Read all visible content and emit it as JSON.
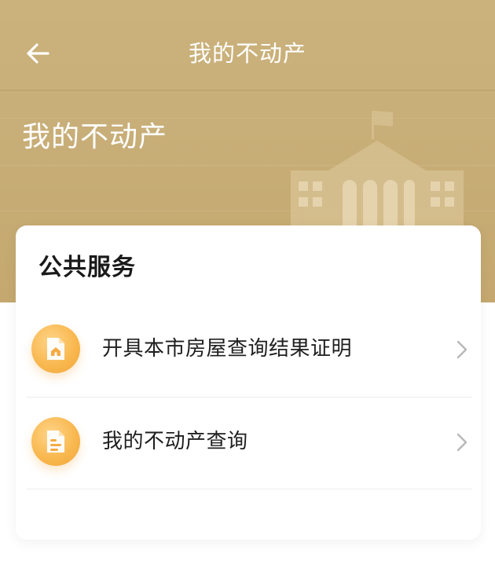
{
  "header": {
    "title": "我的不动产",
    "back_icon": "arrow-left-icon"
  },
  "hero": {
    "title": "我的不动产",
    "illustration": "building-icon"
  },
  "card": {
    "title": "公共服务",
    "items": [
      {
        "label": "开具本市房屋查询结果证明",
        "icon": "house-document-icon"
      },
      {
        "label": "我的不动产查询",
        "icon": "document-list-icon"
      }
    ]
  },
  "colors": {
    "hero": "#c8ae78",
    "accent_icon": "#f8b64c",
    "text": "#1f1f1f"
  }
}
